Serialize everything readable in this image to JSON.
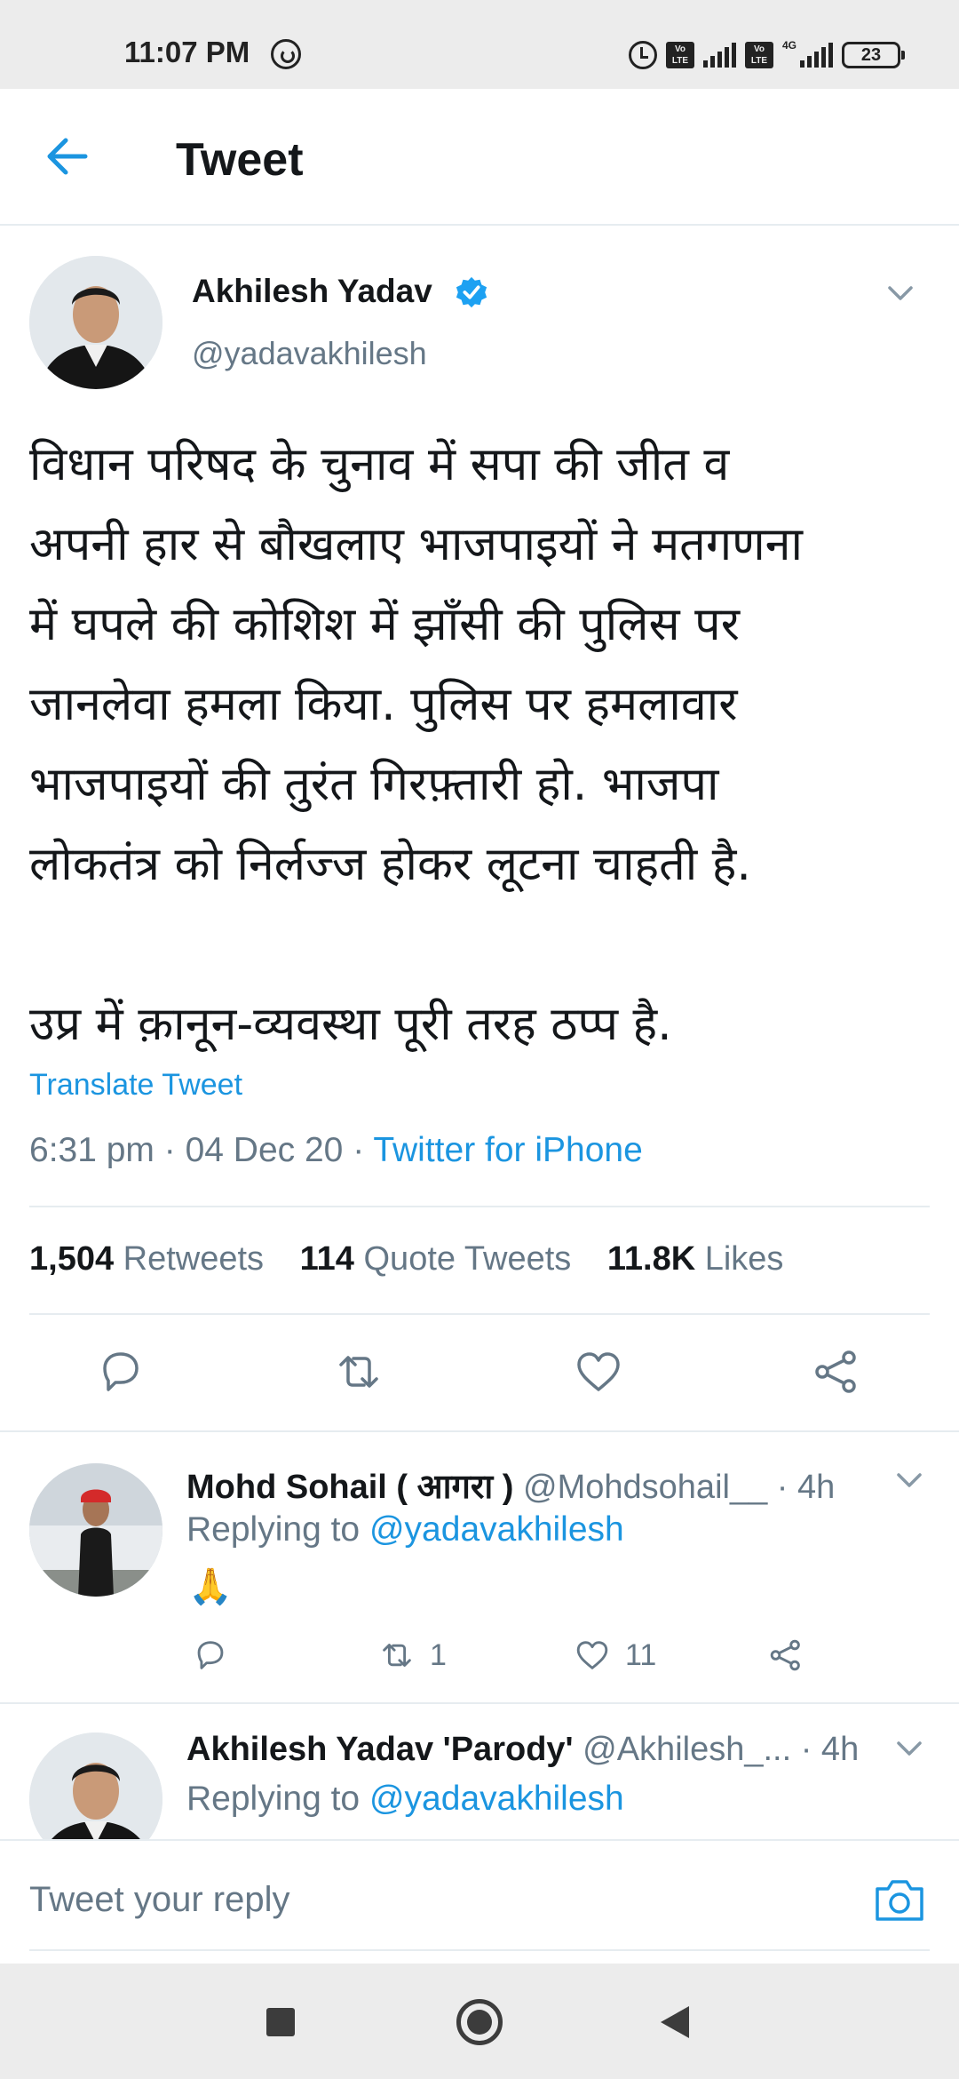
{
  "status_bar": {
    "time": "11:07 PM",
    "volte1": "Vo LTE",
    "volte2": "Vo LTE",
    "network": "4G",
    "battery": "23"
  },
  "header": {
    "title": "Tweet"
  },
  "tweet": {
    "author_name": "Akhilesh Yadav",
    "author_handle": "@yadavakhilesh",
    "verified": true,
    "text_lines": [
      "विधान परिषद के चुनाव में सपा की जीत व",
      "अपनी हार से बौखलाए भाजपाइयों ने मतगणना",
      "में घपले की कोशिश में झाँसी की पुलिस पर",
      "जानलेवा हमला किया. पुलिस पर हमलावार",
      "भाजपाइयों की तुरंत गिरफ़्तारी हो. भाजपा",
      "लोकतंत्र को निर्लज्ज होकर लूटना चाहती है."
    ],
    "text_second_para": "उप्र में क़ानून-व्यवस्था पूरी तरह ठप्प है.",
    "translate_label": "Translate Tweet",
    "time_date": "6:31 pm · 04 Dec 20 · ",
    "source": "Twitter for iPhone",
    "retweets_count": "1,504",
    "retweets_label": "Retweets",
    "quotes_count": "114",
    "quotes_label": "Quote Tweets",
    "likes_count": "11.8K",
    "likes_label": "Likes"
  },
  "replies": [
    {
      "name": "Mohd Sohail ( आगरा )",
      "handle": "@Mohdsohail__",
      "time": "· 4h",
      "replying_label": "Replying to",
      "replying_to": "@yadavakhilesh",
      "text": "🙏",
      "retweets": "1",
      "likes": "11"
    },
    {
      "name": "Akhilesh Yadav 'Parody'",
      "handle": "@Akhilesh_...",
      "time": "· 4h",
      "replying_label": "Replying to",
      "replying_to": "@yadavakhilesh"
    }
  ],
  "composer": {
    "placeholder": "Tweet your reply"
  },
  "colors": {
    "accent": "#1b95e0",
    "muted": "#657786",
    "text": "#14171a",
    "divider": "#e6ecf0"
  }
}
